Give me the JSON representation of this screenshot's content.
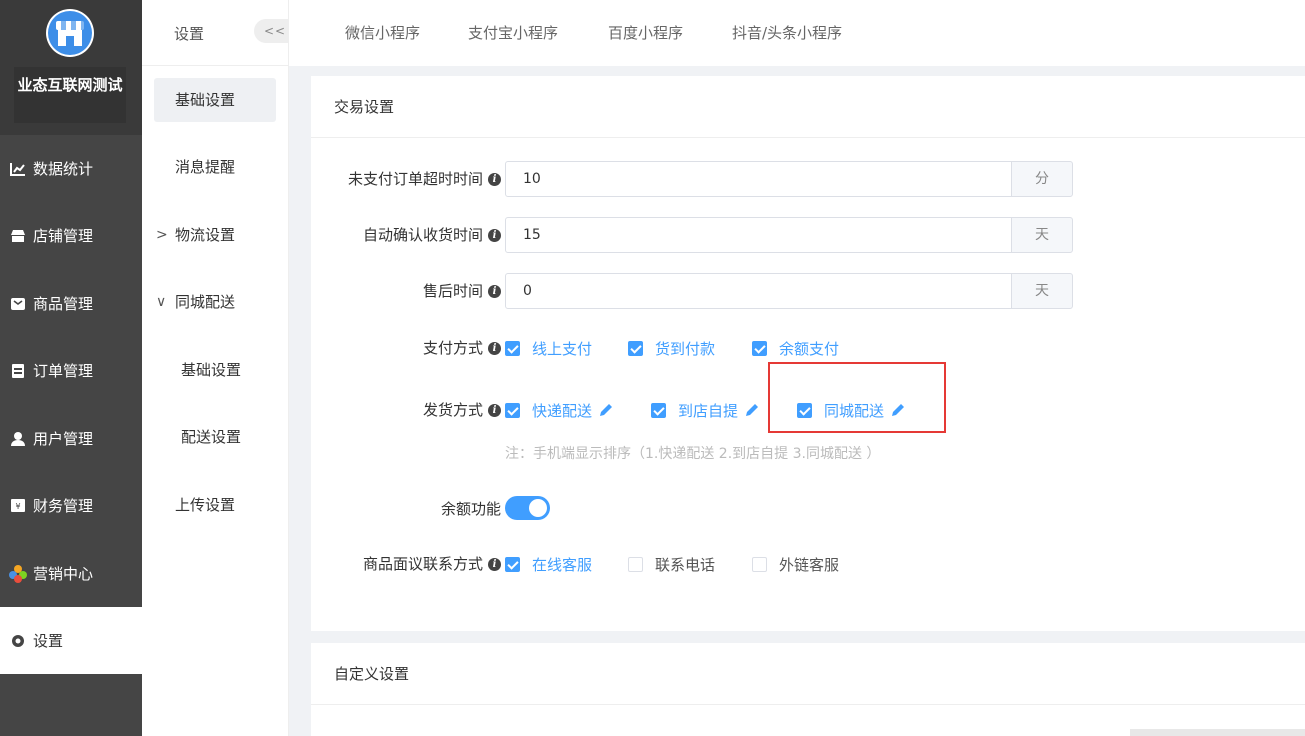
{
  "brand": {
    "name": "业态互联网测试"
  },
  "colors": {
    "accent": "#409eff",
    "sidebar_bg": "#454545",
    "highlight": "#e53935"
  },
  "sidebar": {
    "items": [
      {
        "label": "数据统计",
        "icon": "chart-icon"
      },
      {
        "label": "店铺管理",
        "icon": "store-icon"
      },
      {
        "label": "商品管理",
        "icon": "goods-icon"
      },
      {
        "label": "订单管理",
        "icon": "order-icon"
      },
      {
        "label": "用户管理",
        "icon": "user-icon"
      },
      {
        "label": "财务管理",
        "icon": "finance-icon"
      },
      {
        "label": "营销中心",
        "icon": "marketing-icon"
      },
      {
        "label": "设置",
        "icon": "gear-icon",
        "active": true
      }
    ]
  },
  "subnav": {
    "title": "设置",
    "collapse": "<<",
    "items": [
      {
        "label": "基础设置",
        "active": true
      },
      {
        "label": "消息提醒"
      },
      {
        "label": "物流设置",
        "arrow": ">"
      },
      {
        "label": "同城配送",
        "arrow": "∨"
      },
      {
        "label": "基础设置",
        "child": true
      },
      {
        "label": "配送设置",
        "child": true
      },
      {
        "label": "上传设置"
      }
    ]
  },
  "tabs": [
    "微信小程序",
    "支付宝小程序",
    "百度小程序",
    "抖音/头条小程序"
  ],
  "trade": {
    "title": "交易设置",
    "unpaid_timeout": {
      "label": "未支付订单超时时间",
      "value": "10",
      "unit": "分"
    },
    "auto_confirm": {
      "label": "自动确认收货时间",
      "value": "15",
      "unit": "天"
    },
    "after_sale": {
      "label": "售后时间",
      "value": "0",
      "unit": "天"
    },
    "payment": {
      "label": "支付方式",
      "options": [
        {
          "label": "线上支付",
          "checked": true
        },
        {
          "label": "货到付款",
          "checked": true
        },
        {
          "label": "余额支付",
          "checked": true
        }
      ]
    },
    "delivery": {
      "label": "发货方式",
      "options": [
        {
          "label": "快递配送",
          "checked": true
        },
        {
          "label": "到店自提",
          "checked": true
        },
        {
          "label": "同城配送",
          "checked": true
        }
      ],
      "note": "注：手机端显示排序（1.快递配送 2.到店自提 3.同城配送 ）"
    },
    "balance": {
      "label": "余额功能",
      "enabled": true
    },
    "contact": {
      "label": "商品面议联系方式",
      "options": [
        {
          "label": "在线客服",
          "checked": true
        },
        {
          "label": "联系电话",
          "checked": false
        },
        {
          "label": "外链客服",
          "checked": false
        }
      ]
    }
  },
  "custom": {
    "title": "自定义设置"
  }
}
